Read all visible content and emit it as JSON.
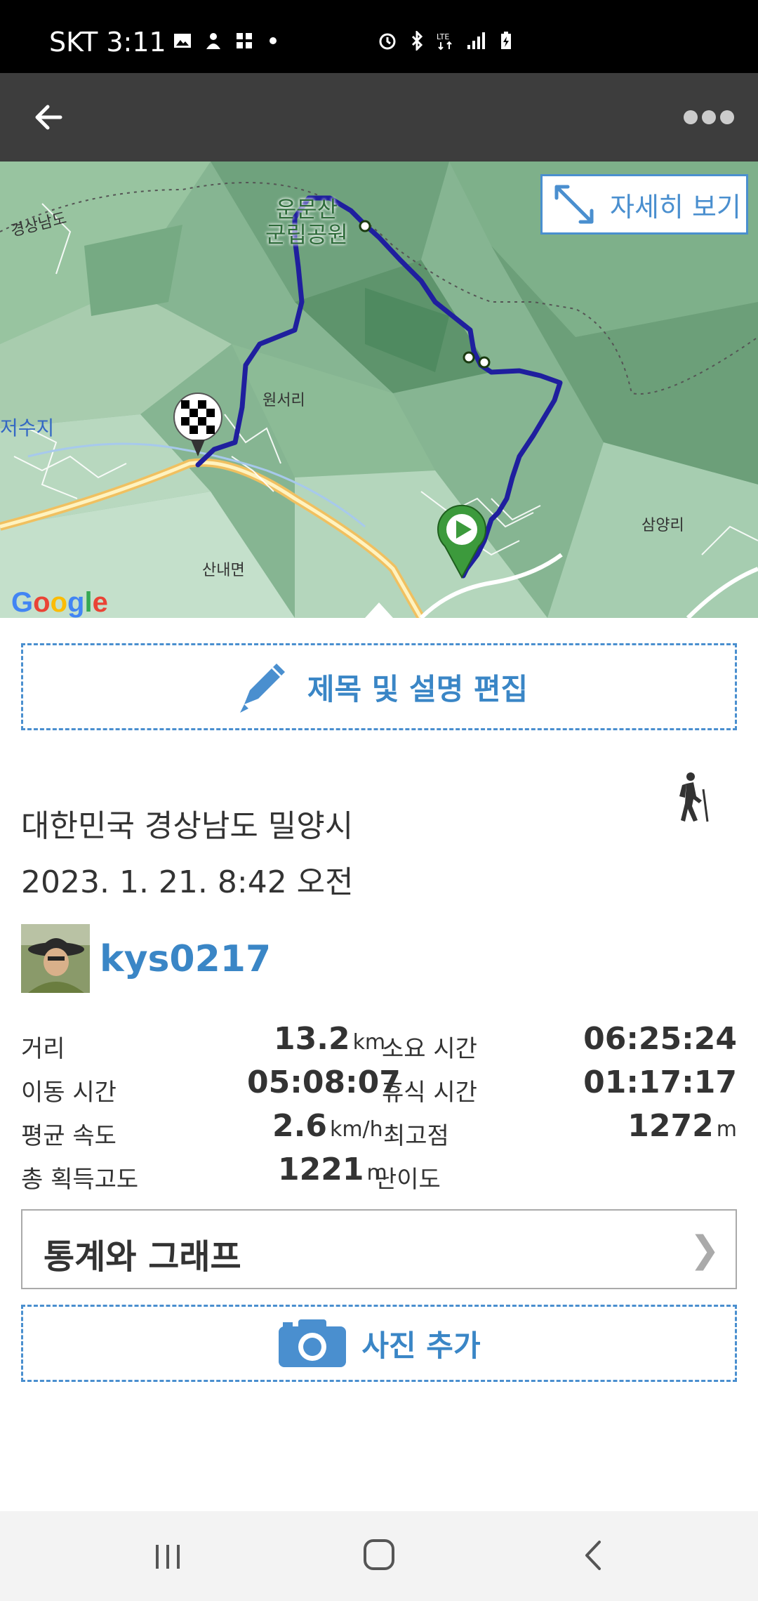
{
  "status_bar": {
    "carrier_time": "SKT 3:11"
  },
  "app_bar": {
    "back_icon": "arrow-left-icon",
    "more_icon": "more-dots-icon"
  },
  "map": {
    "expand_label": "자세히 보기",
    "labels": {
      "park": "운문산\n군립공원",
      "region_gyeongnam": "경상남도",
      "village_wonseo": "원서리",
      "reservoir": "저수지",
      "sannae": "산내면",
      "samyang": "삼양리"
    },
    "logo": "Google"
  },
  "edit_button": {
    "label": "제목 및 설명 편집",
    "icon": "pencil-icon"
  },
  "activity": {
    "location": "대한민국 경상남도 밀양시",
    "datetime": "2023. 1. 21. 8:42 오전",
    "type_icon": "hiker-icon"
  },
  "user": {
    "name": "kys0217"
  },
  "stats": {
    "distance_label": "거리",
    "distance_value": "13.2",
    "distance_unit": "km",
    "duration_label": "소요 시간",
    "duration_value": "06:25:24",
    "moving_label": "이동 시간",
    "moving_value": "05:08:07",
    "rest_label": "휴식 시간",
    "rest_value": "01:17:17",
    "avg_speed_label": "평균 속도",
    "avg_speed_value": "2.6",
    "avg_speed_unit": "km/h",
    "max_elev_label": "최고점",
    "max_elev_value": "1272",
    "max_elev_unit": "m",
    "gain_label": "총 획득고도",
    "gain_value": "1221",
    "gain_unit": "m",
    "difficulty_label": "난이도"
  },
  "graph_button": {
    "label": "통계와 그래프",
    "chevron": "❯"
  },
  "photo_button": {
    "label": "사진 추가",
    "icon": "camera-icon"
  },
  "colors": {
    "accent": "#4a8fcf",
    "route": "#1f1f9e",
    "appbar": "#3d3d3d"
  }
}
